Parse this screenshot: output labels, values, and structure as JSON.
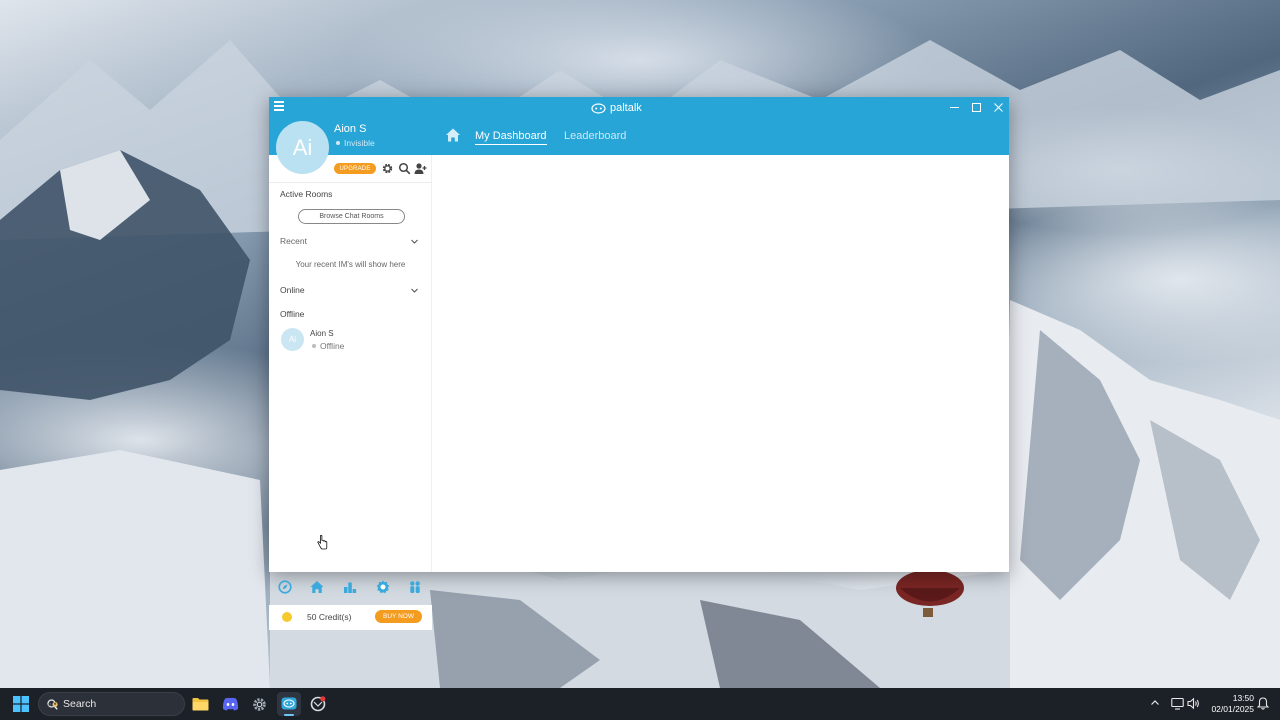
{
  "app": {
    "title": "paltalk",
    "colors": {
      "accent": "#28a5d7",
      "upgrade": "#f39c1f",
      "coin": "#f6c92e"
    }
  },
  "user": {
    "initials": "Ai",
    "name": "Aion S",
    "status": "Invisible"
  },
  "header": {
    "tabs": [
      {
        "label": "My Dashboard",
        "active": true
      },
      {
        "label": "Leaderboard",
        "active": false
      }
    ]
  },
  "toolbar": {
    "upgrade_label": "UPGRADE",
    "icons": [
      "gear-icon",
      "search-icon",
      "add-user-icon"
    ]
  },
  "sidebar": {
    "active_rooms": {
      "title": "Active Rooms",
      "browse_label": "Browse Chat Rooms"
    },
    "recent": {
      "title": "Recent",
      "empty_text": "Your recent IM's will show here"
    },
    "online": {
      "title": "Online"
    },
    "offline": {
      "title": "Offline",
      "contacts": [
        {
          "initials": "Ai",
          "name": "Aion S",
          "status": "Offline"
        }
      ]
    },
    "bottom_nav": [
      "compass-icon",
      "home-icon",
      "leaderboard-icon",
      "badge-icon",
      "people-icon"
    ],
    "credits": {
      "text": "50 Credit(s)",
      "buy_label": "BUY NOW"
    }
  },
  "taskbar": {
    "search_placeholder": "Search",
    "apps": [
      "file-explorer-icon",
      "discord-icon",
      "settings-icon",
      "paltalk-icon",
      "browser-icon"
    ],
    "clock": {
      "time": "13:50",
      "date": "02/01/2025"
    }
  }
}
